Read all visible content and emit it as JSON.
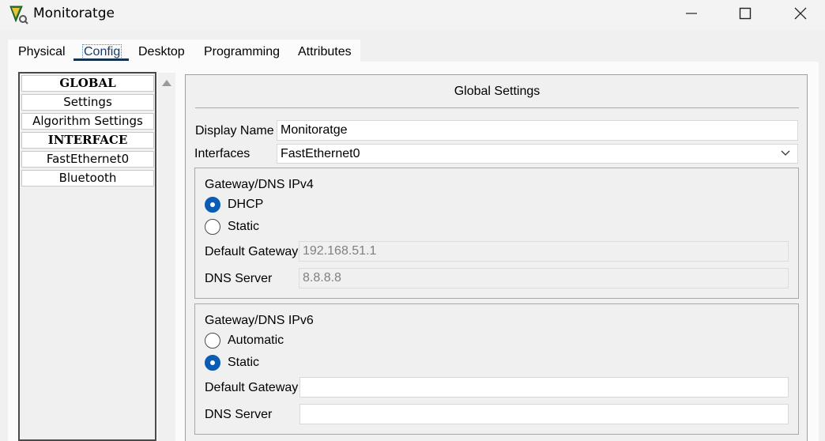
{
  "window": {
    "title": "Monitoratge"
  },
  "tabs": [
    {
      "label": "Physical"
    },
    {
      "label": "Config"
    },
    {
      "label": "Desktop"
    },
    {
      "label": "Programming"
    },
    {
      "label": "Attributes"
    }
  ],
  "sidebar": {
    "items": [
      {
        "label": "GLOBAL"
      },
      {
        "label": "Settings"
      },
      {
        "label": "Algorithm Settings"
      },
      {
        "label": "INTERFACE"
      },
      {
        "label": "FastEthernet0"
      },
      {
        "label": "Bluetooth"
      }
    ]
  },
  "global": {
    "title": "Global Settings",
    "display_name_label": "Display Name",
    "display_name_value": "Monitoratge",
    "interfaces_label": "Interfaces",
    "interfaces_value": "FastEthernet0"
  },
  "ipv4": {
    "title": "Gateway/DNS IPv4",
    "option1": "DHCP",
    "option2": "Static",
    "selected": "DHCP",
    "gateway_label": "Default Gateway",
    "gateway_value": "192.168.51.1",
    "dns_label": "DNS Server",
    "dns_value": "8.8.8.8"
  },
  "ipv6": {
    "title": "Gateway/DNS IPv6",
    "option1": "Automatic",
    "option2": "Static",
    "selected": "Static",
    "gateway_label": "Default Gateway",
    "gateway_value": "",
    "dns_label": "DNS Server",
    "dns_value": ""
  },
  "colors": {
    "accent": "#0a5cb5",
    "tab_underline": "#13334f"
  }
}
